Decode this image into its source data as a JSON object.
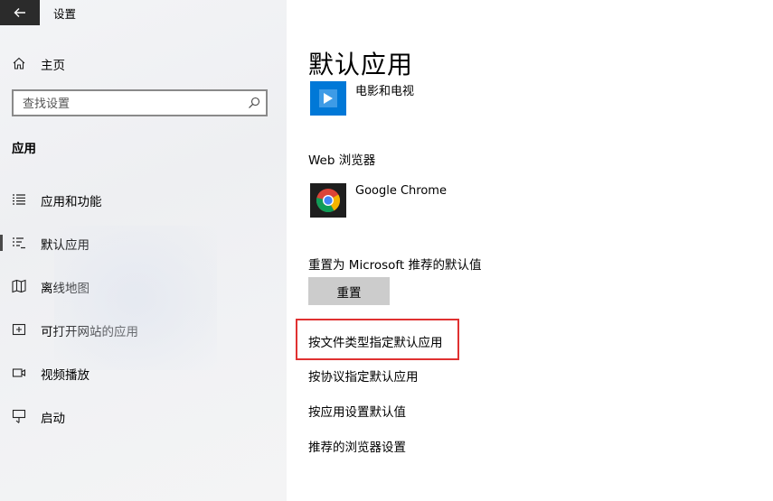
{
  "window": {
    "title": "设置"
  },
  "sidebar": {
    "home_label": "主页",
    "search_placeholder": "查找设置",
    "section_title": "应用",
    "items": [
      {
        "label": "应用和功能",
        "icon": "apps-list-icon",
        "selected": false
      },
      {
        "label": "默认应用",
        "icon": "default-apps-icon",
        "selected": true
      },
      {
        "label": "离线地图",
        "icon": "offline-map-icon",
        "selected": false
      },
      {
        "label": "可打开网站的应用",
        "icon": "open-website-icon",
        "selected": false
      },
      {
        "label": "视频播放",
        "icon": "video-icon",
        "selected": false
      },
      {
        "label": "启动",
        "icon": "startup-icon",
        "selected": false
      }
    ]
  },
  "main": {
    "title": "默认应用",
    "video_app": {
      "name": "电影和电视",
      "icon": "movies-tv-icon"
    },
    "browser_heading": "Web 浏览器",
    "browser_app": {
      "name": "Google Chrome",
      "icon": "chrome-icon"
    },
    "reset_label": "重置为 Microsoft 推荐的默认值",
    "reset_button": "重置",
    "links": [
      "按文件类型指定默认应用",
      "按协议指定默认应用",
      "按应用设置默认值",
      "推荐的浏览器设置"
    ],
    "highlight_color": "#e03131",
    "accent_color": "#0078d7"
  }
}
